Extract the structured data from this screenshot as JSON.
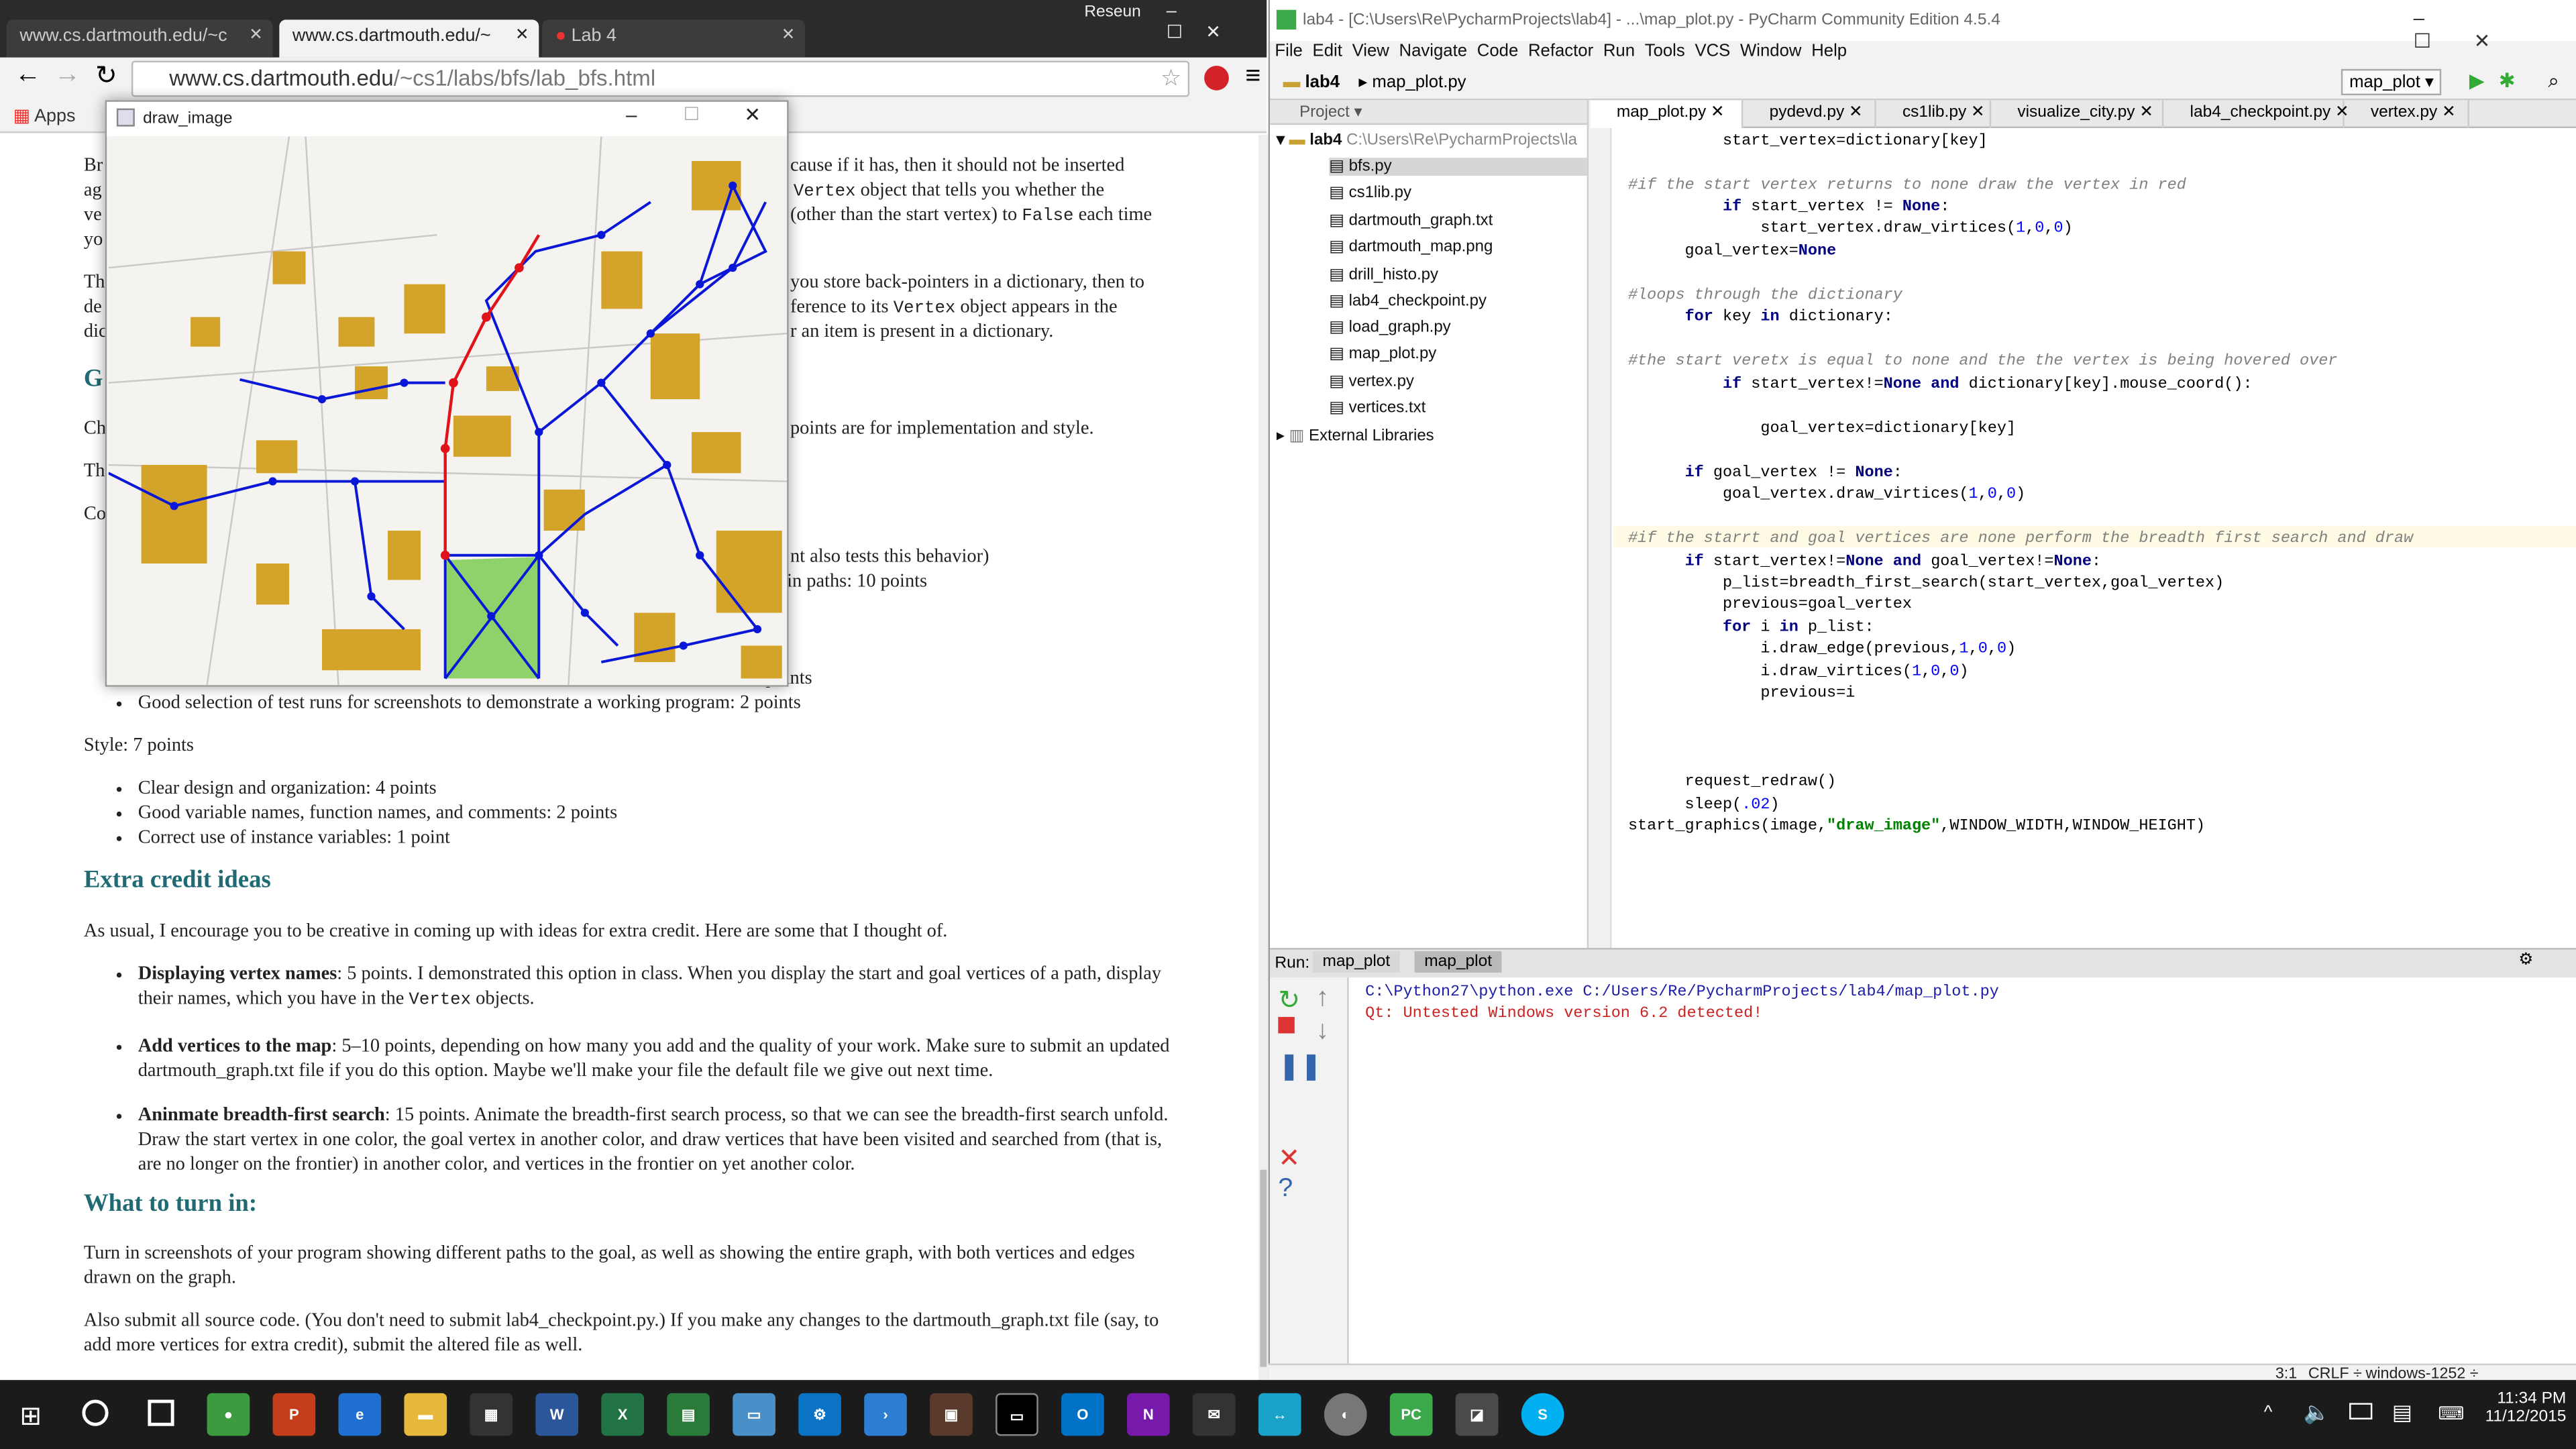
{
  "chrome": {
    "tabs": [
      "www.cs.dartmouth.edu/~c",
      "www.cs.dartmouth.edu/~",
      "Lab 4"
    ],
    "profile": "Reseun",
    "url_host": "www.cs.dartmouth.edu",
    "url_path": "/~cs1/labs/bfs/lab_bfs.html",
    "bookmark_apps": "Apps"
  },
  "page": {
    "l1": "Br",
    "l1b": "cause if it has, then it should not be inserted",
    "l2": "ag",
    "l2b_pre": "",
    "l2b_code": "Vertex",
    "l2b_post": " object that tells you whether the",
    "l3": "ve",
    "l3b": "(other than the start vertex) to ",
    "l3b_code": "False",
    "l3b_post": " each time",
    "l4": "yo",
    "l5": "Th",
    "l5b": "you store back-pointers in a dictionary, then to",
    "l6": "de",
    "l6b": "ference to its ",
    "l6b_code": "Vertex",
    "l6b_post": " object appears in the",
    "l7": "dic",
    "l7b": "r an item is present in a dictionary.",
    "h_grading": "G",
    "l8": "Ch",
    "l8b": "points are for implementation and style.",
    "l9": "Th",
    "l10": "Co",
    "l11b": "nt also tests this behavior)",
    "l12b": "in paths: 10 points",
    "l13b": "points",
    "bullet_screenshots": "Good selection of test runs for screenshots to demonstrate a working program: 2 points",
    "style_head": "Style: 7 points",
    "style_items": [
      "Clear design and organization: 4 points",
      "Good variable names, function names, and comments: 2 points",
      "Correct use of instance variables: 1 point"
    ],
    "h_extra": "Extra credit ideas",
    "extra_intro": "As usual, I encourage you to be creative in coming up with ideas for extra credit. Here are some that I thought of.",
    "ec1_bold": "Displaying vertex names",
    "ec1_text": ": 5 points. I demonstrated this option in class. When you display the start and goal vertices of a path, display their names, which you have in the ",
    "ec1_code": "Vertex",
    "ec1_end": " objects.",
    "ec2_bold": "Add vertices to the map",
    "ec2_text": ": 5–10 points, depending on how many you add and the quality of your work. Make sure to submit an updated dartmouth_graph.txt file if you do this option. Maybe we'll make your file the default file we give out next time.",
    "ec3_bold": "Aninmate breadth-first search",
    "ec3_text": ": 15 points. Animate the breadth-first search process, so that we can see the breadth-first search unfold. Draw the start vertex in one color, the goal vertex in another color, and draw vertices that have been visited and searched from (that is, are no longer on the frontier) in another color, and vertices in the frontier on yet another color.",
    "h_turnin": "What to turn in:",
    "turnin1": "Turn in screenshots of your program showing different paths to the goal, as well as showing the entire graph, with both vertices and edges drawn on the graph.",
    "turnin2": "Also submit all source code. (You don't need to submit lab4_checkpoint.py.) If you make any changes to the dartmouth_graph.txt file (say, to add more vertices for extra credit), submit the altered file as well."
  },
  "drawwin": {
    "title": "draw_image"
  },
  "pycharm": {
    "title": "lab4 - [C:\\Users\\Re\\PycharmProjects\\lab4] - ...\\map_plot.py - PyCharm Community Edition 4.5.4",
    "menu": [
      "File",
      "Edit",
      "View",
      "Navigate",
      "Code",
      "Refactor",
      "Run",
      "Tools",
      "VCS",
      "Window",
      "Help"
    ],
    "crumb1": "lab4",
    "crumb2": "map_plot.py",
    "run_config": "map_plot",
    "project_label": "Project",
    "root": "lab4",
    "root_path": "C:\\Users\\Re\\PycharmProjects\\la",
    "files": [
      "bfs.py",
      "cs1lib.py",
      "dartmouth_graph.txt",
      "dartmouth_map.png",
      "drill_histo.py",
      "lab4_checkpoint.py",
      "load_graph.py",
      "map_plot.py",
      "vertex.py",
      "vertices.txt"
    ],
    "ext_libs": "External Libraries",
    "editor_tabs": [
      "map_plot.py",
      "pydevd.py",
      "cs1lib.py",
      "visualize_city.py",
      "lab4_checkpoint.py",
      "vertex.py"
    ],
    "run_label": "Run:",
    "run_tabs": [
      "map_plot",
      "map_plot"
    ],
    "out1": "C:\\Python27\\python.exe C:/Users/Re/PycharmProjects/lab4/map_plot.py",
    "out2": "Qt: Untested Windows version 6.2 detected!",
    "status_pos": "3:1",
    "status_crlf": "CRLF ÷",
    "status_enc": "windows-1252 ÷"
  },
  "taskbar": {
    "time": "11:34 PM",
    "date": "11/12/2015"
  },
  "colors": {
    "heading": "#1f6a73",
    "path": "#e0131a",
    "edge": "#0a17d6",
    "building": "#d4a32a",
    "green": "#8fd16a"
  }
}
